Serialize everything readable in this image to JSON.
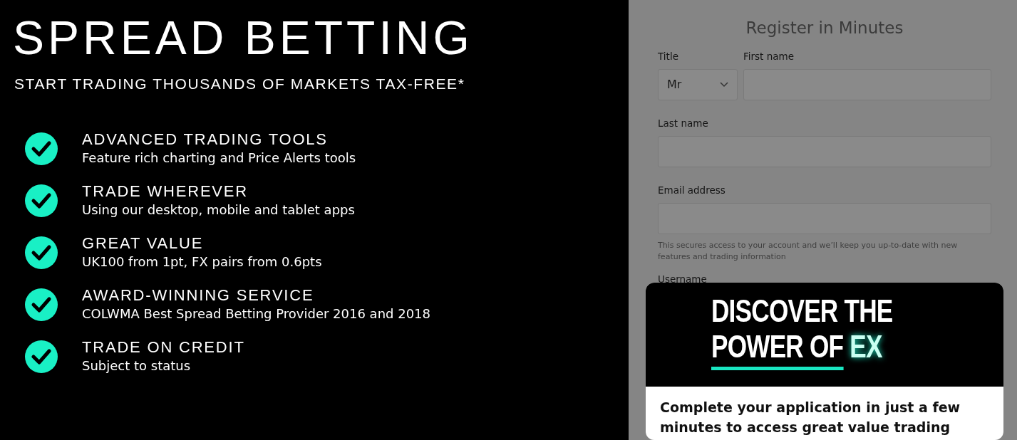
{
  "hero": {
    "title": "SPREAD BETTING",
    "subtitle": "START TRADING THOUSANDS OF MARKETS TAX-FREE*"
  },
  "features": [
    {
      "heading": "ADVANCED TRADING TOOLS",
      "text": "Feature rich charting and Price Alerts tools"
    },
    {
      "heading": "TRADE WHEREVER",
      "text": "Using our desktop, mobile and tablet apps"
    },
    {
      "heading": "GREAT VALUE",
      "text": "UK100 from 1pt, FX pairs from 0.6pts"
    },
    {
      "heading": "AWARD-WINNING SERVICE",
      "text": "COLWMA Best Spread Betting Provider 2016 and 2018"
    },
    {
      "heading": "TRADE ON CREDIT",
      "text": "Subject to status"
    }
  ],
  "form": {
    "heading": "Register in Minutes",
    "title_field": {
      "label": "Title",
      "value": "Mr"
    },
    "first_name": {
      "label": "First name"
    },
    "last_name": {
      "label": "Last name"
    },
    "email": {
      "label": "Email address",
      "help": "This secures access to your account and we’ll keep you up-to-date with new features and trading information"
    },
    "username": {
      "label": "Username"
    }
  },
  "popup": {
    "headline_line1": "DISCOVER THE",
    "headline_line2": "POWER OF",
    "headline_accent": "EX",
    "message": "Complete your application in just a few minutes to access great value trading"
  }
}
